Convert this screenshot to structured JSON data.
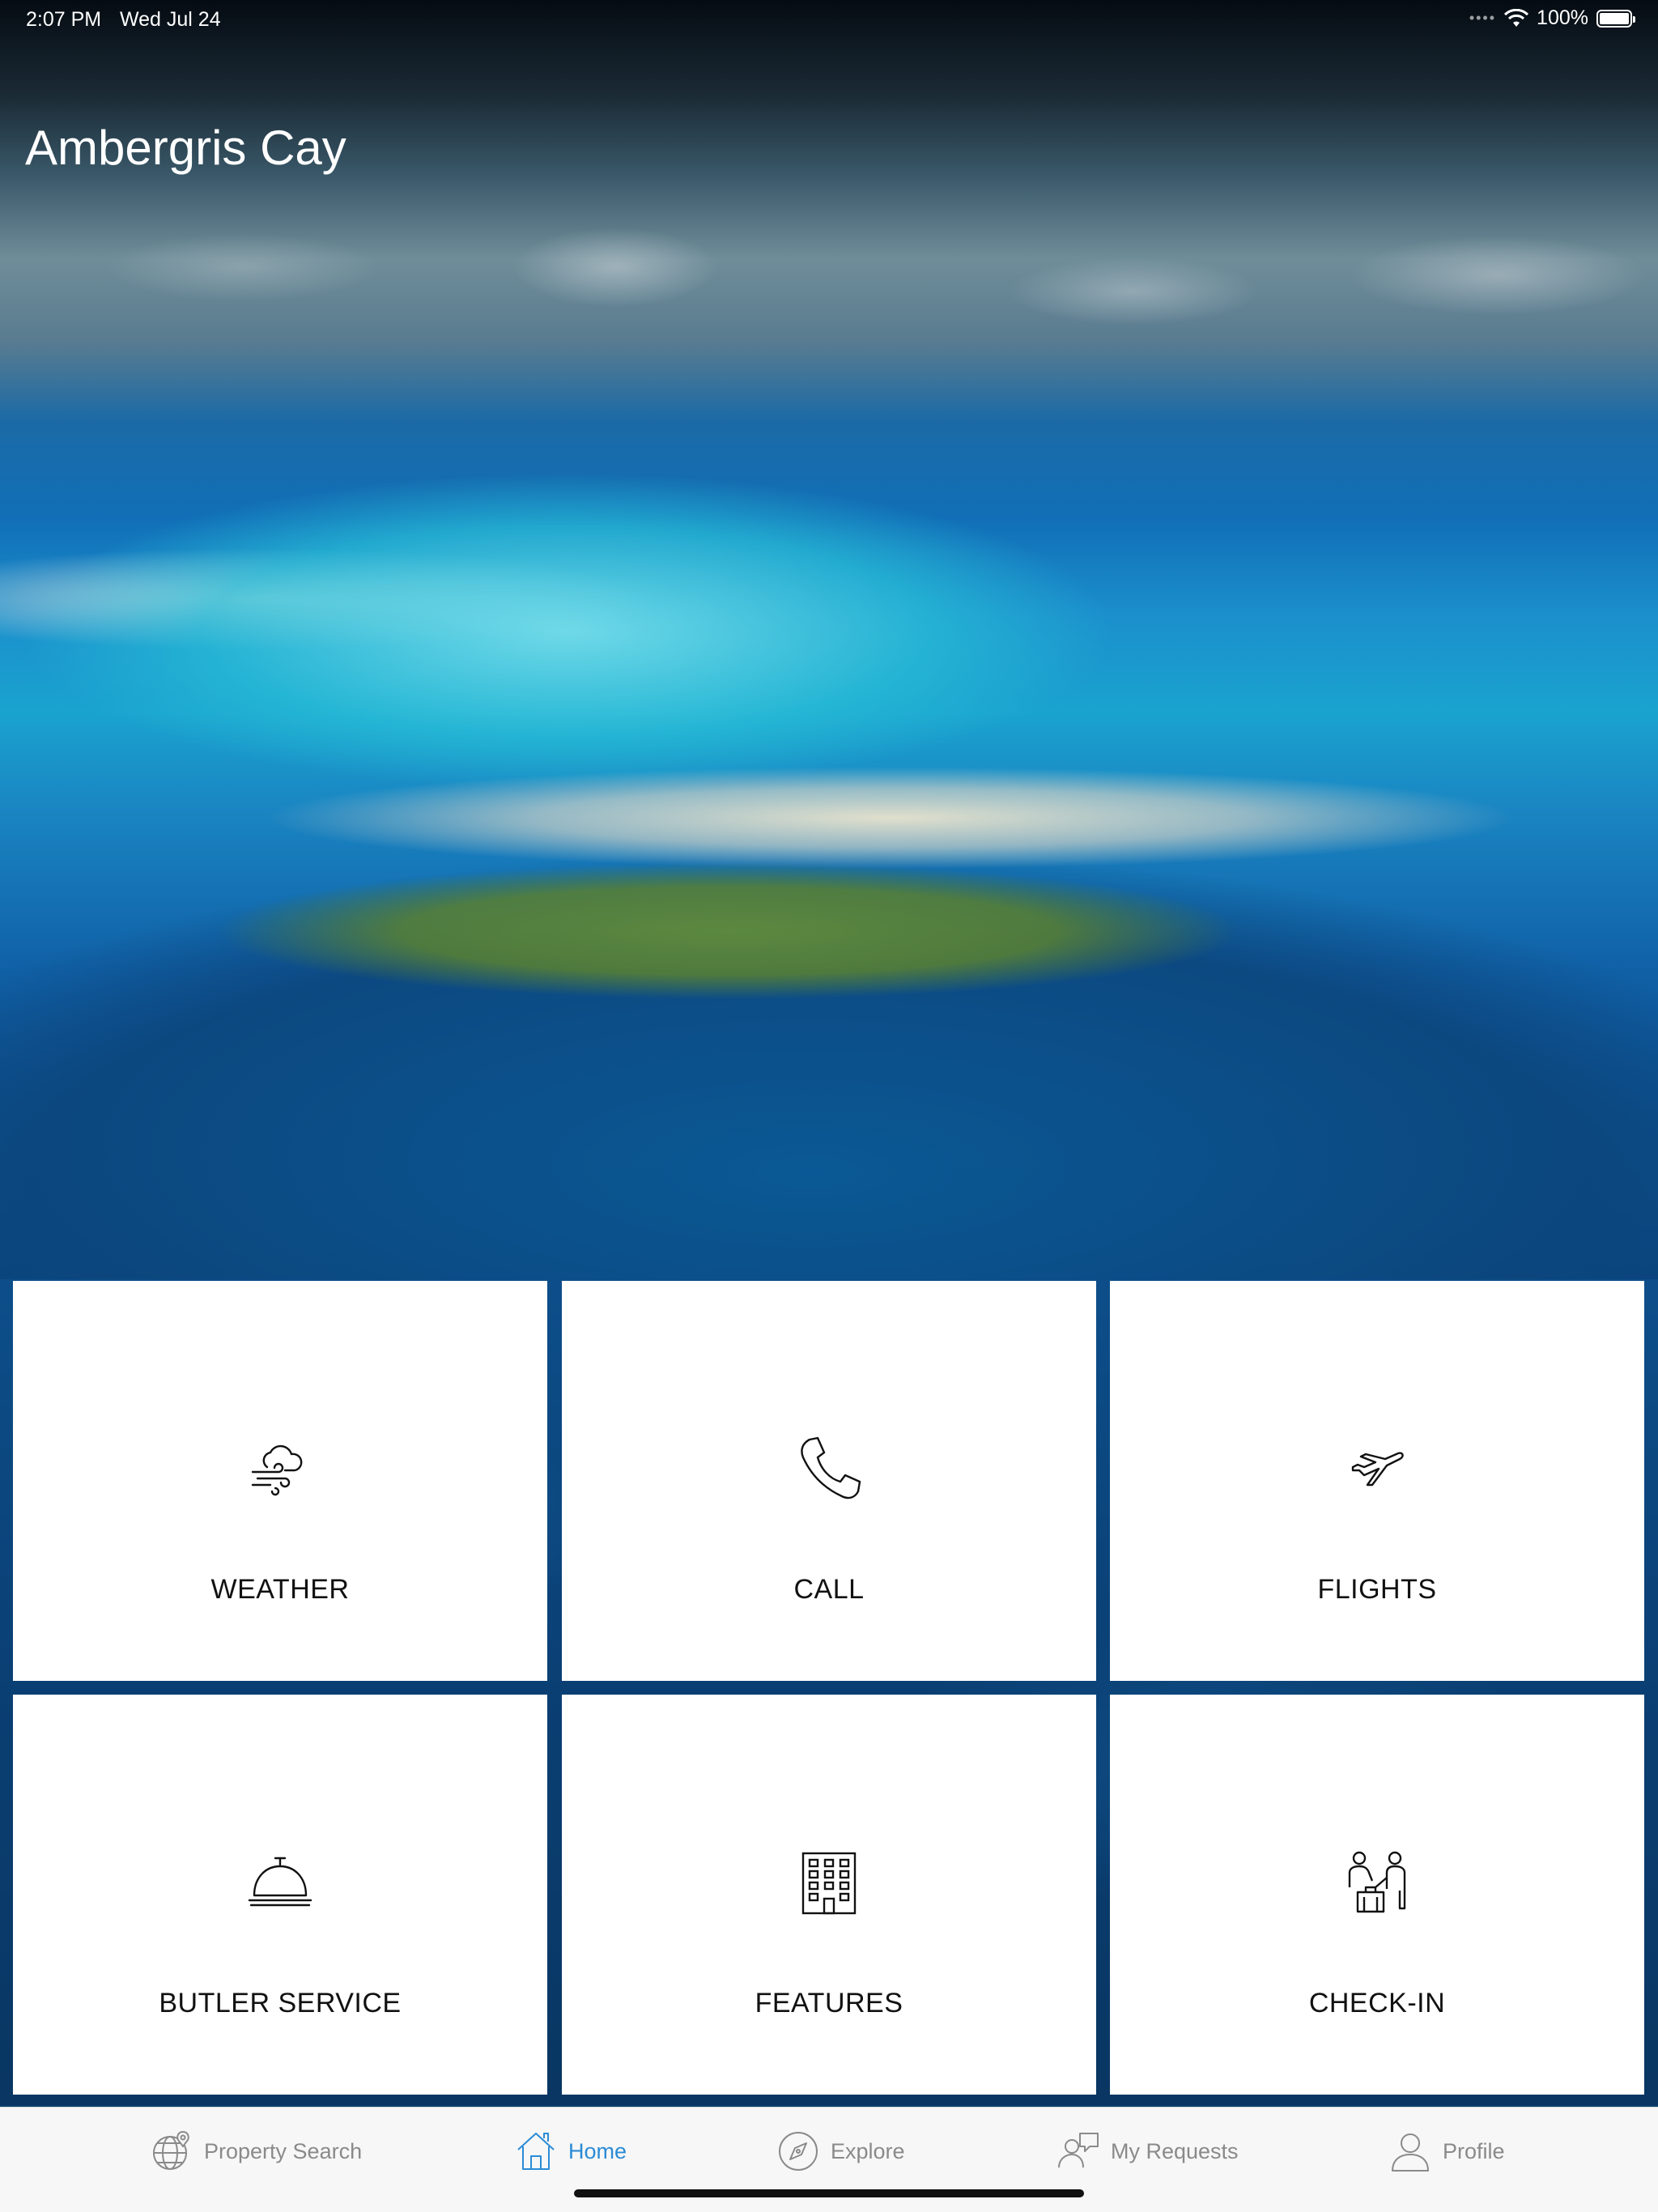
{
  "status_bar": {
    "time": "2:07 PM",
    "date": "Wed Jul 24",
    "battery": "100%"
  },
  "header": {
    "title": "Ambergris Cay"
  },
  "tiles": [
    {
      "label": "WEATHER",
      "icon": "weather-cloud-wind-icon"
    },
    {
      "label": "CALL",
      "icon": "phone-icon"
    },
    {
      "label": "FLIGHTS",
      "icon": "airplane-icon"
    },
    {
      "label": "BUTLER SERVICE",
      "icon": "service-bell-icon"
    },
    {
      "label": "FEATURES",
      "icon": "building-icon"
    },
    {
      "label": "CHECK-IN",
      "icon": "check-in-luggage-icon"
    }
  ],
  "tab_bar": {
    "items": [
      {
        "label": "Property Search",
        "icon": "globe-icon"
      },
      {
        "label": "Home",
        "icon": "house-icon",
        "active": true
      },
      {
        "label": "Explore",
        "icon": "compass-icon"
      },
      {
        "label": "My Requests",
        "icon": "chat-person-icon"
      },
      {
        "label": "Profile",
        "icon": "person-icon"
      }
    ],
    "active_color": "#2b8bd6",
    "inactive_color": "#8a8a8a"
  }
}
